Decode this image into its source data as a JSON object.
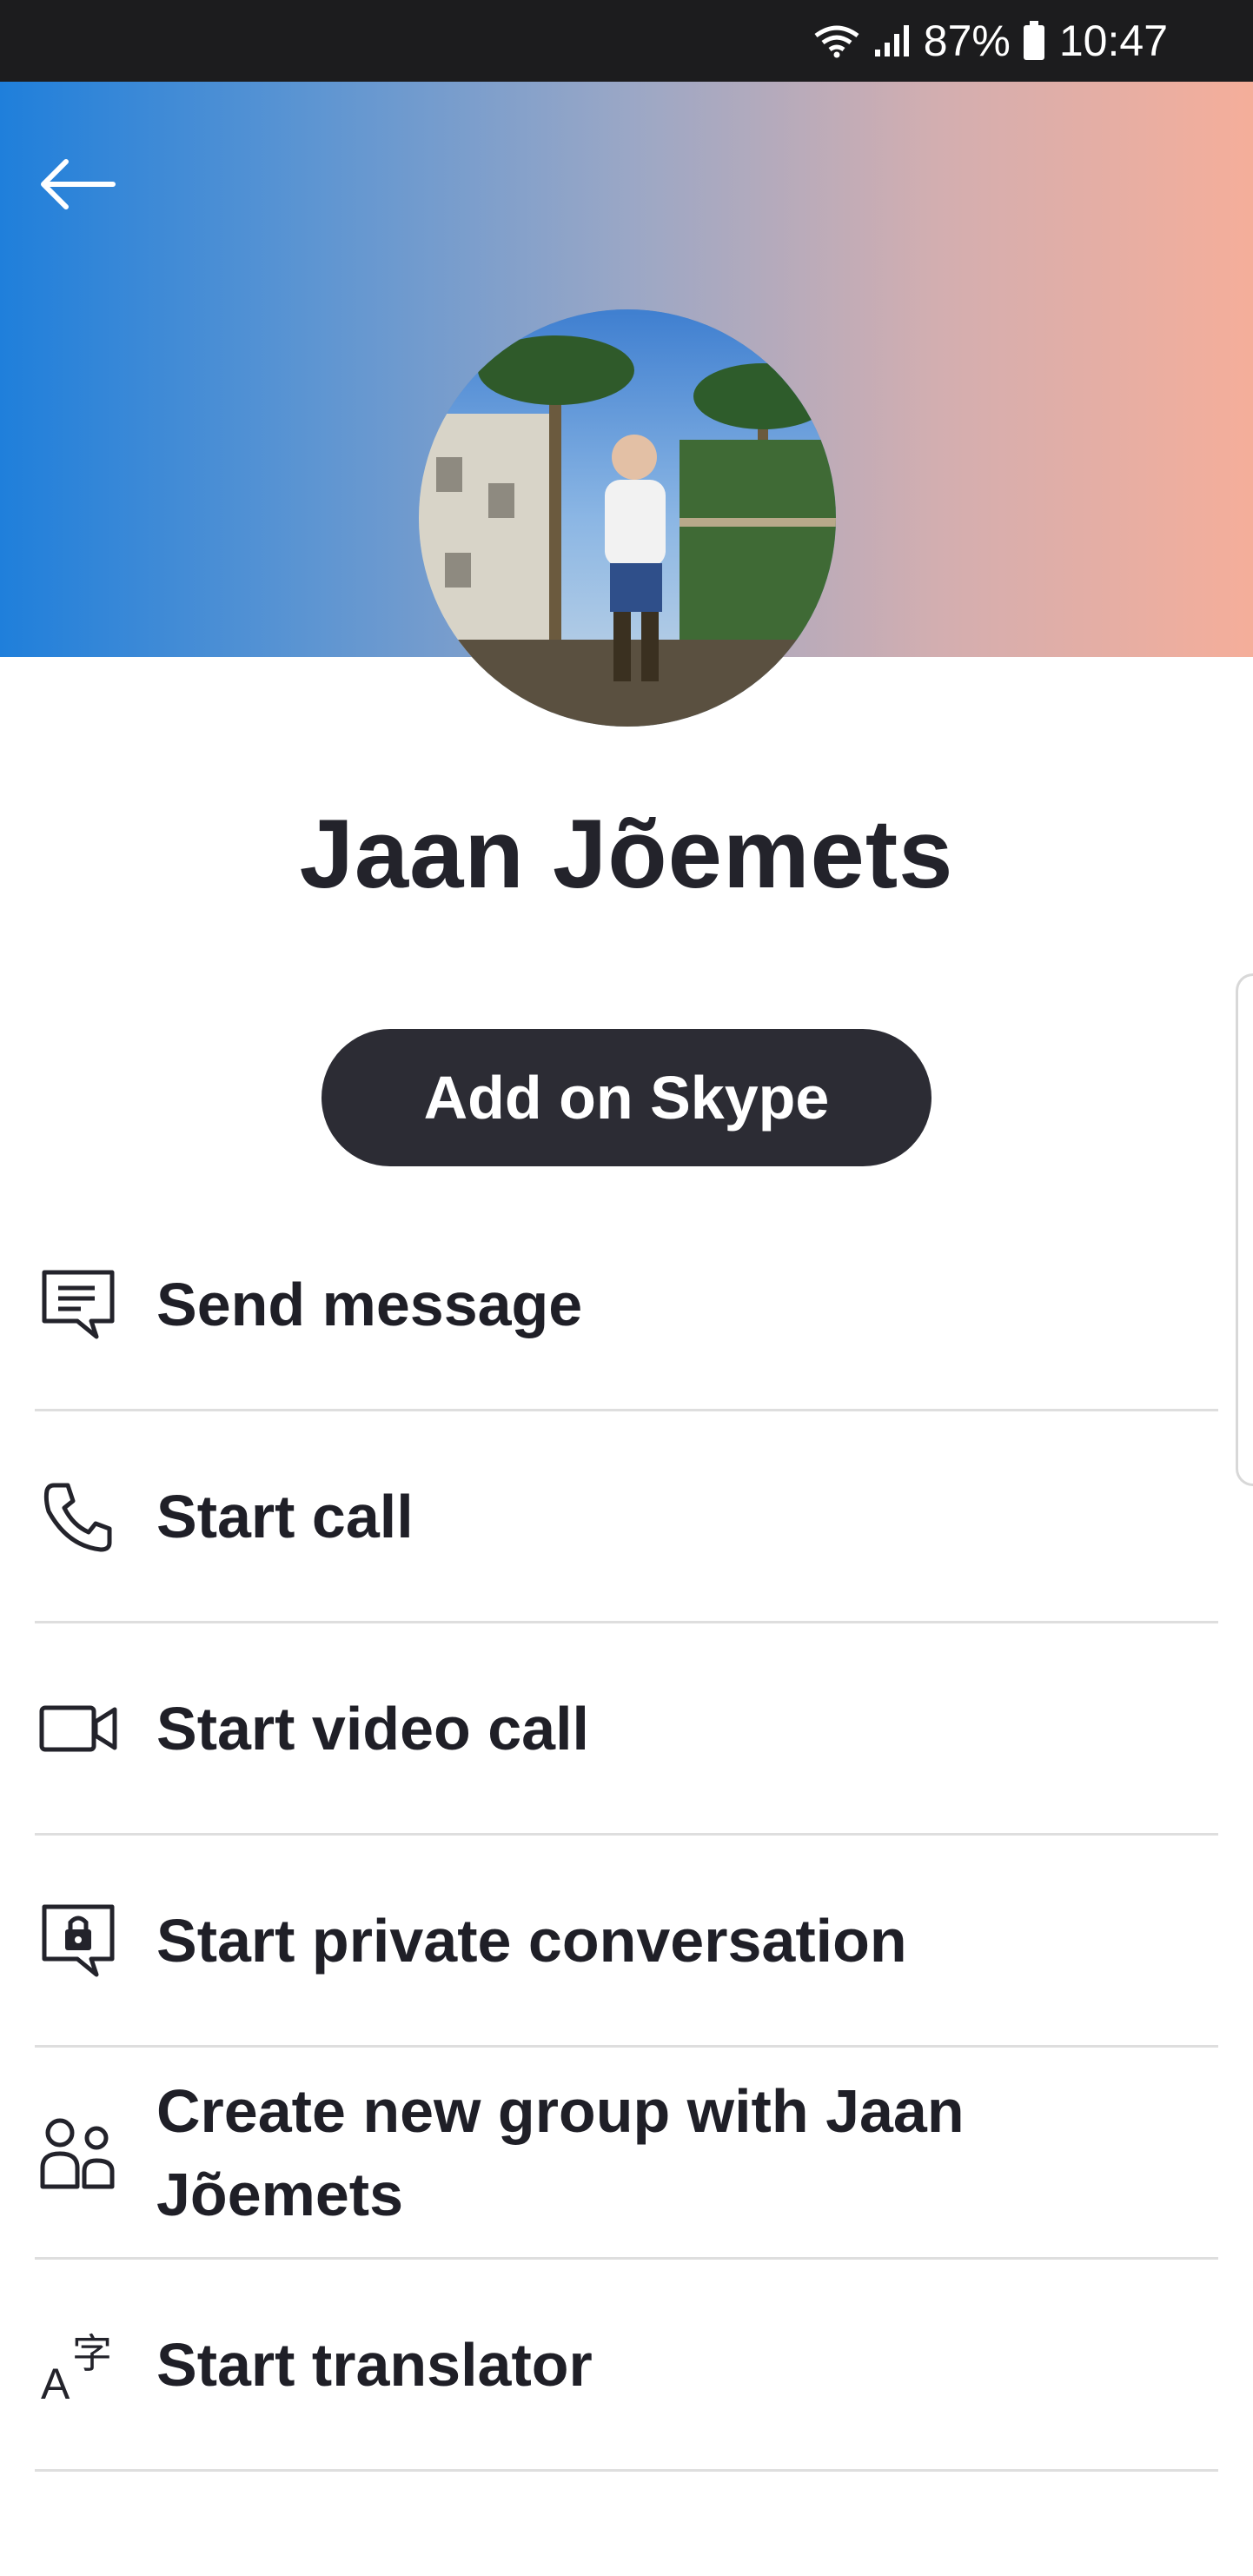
{
  "status_bar": {
    "battery_percent": "87%",
    "time": "10:47"
  },
  "header": {
    "back_icon": "back-arrow-icon"
  },
  "profile": {
    "name": "Jaan Jõemets"
  },
  "add_button": {
    "label": "Add on Skype"
  },
  "actions": [
    {
      "icon": "message-icon",
      "label": "Send message"
    },
    {
      "icon": "phone-icon",
      "label": "Start call"
    },
    {
      "icon": "video-camera-icon",
      "label": "Start video call"
    },
    {
      "icon": "lock-chat-icon",
      "label": "Start private conversation"
    },
    {
      "icon": "group-icon",
      "label": "Create new group with Jaan Jõemets"
    },
    {
      "icon": "translator-icon",
      "label": "Start translator"
    }
  ],
  "colors": {
    "gradient_start": "#1f7fdb",
    "gradient_end": "#f5ae9a",
    "button_bg": "#2c2c34"
  }
}
